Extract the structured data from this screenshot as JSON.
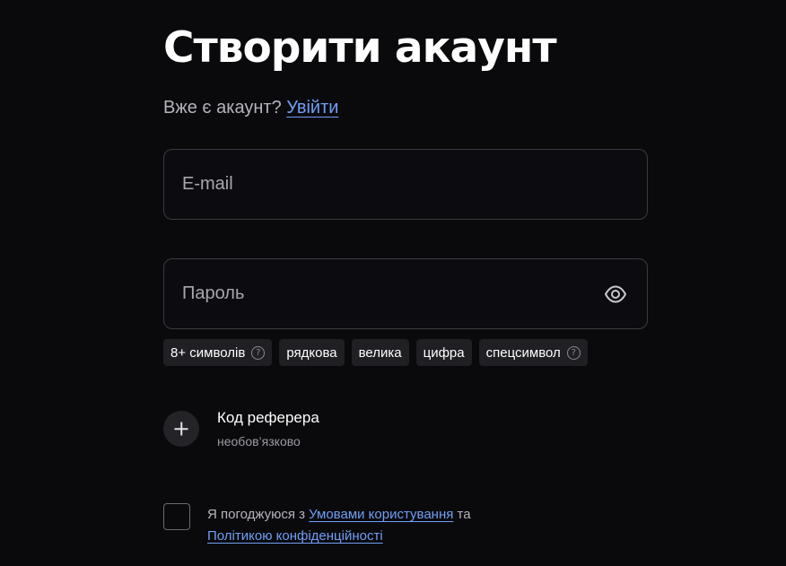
{
  "title": "Створити акаунт",
  "login": {
    "prompt": "Вже є акаунт?",
    "link": "Увійти"
  },
  "email": {
    "placeholder": "E-mail",
    "value": ""
  },
  "password": {
    "placeholder": "Пароль",
    "value": "",
    "toggle_icon": "eye-icon"
  },
  "requirements": [
    {
      "label": "8+ символів",
      "has_help": true
    },
    {
      "label": "рядкова",
      "has_help": false
    },
    {
      "label": "велика",
      "has_help": false
    },
    {
      "label": "цифра",
      "has_help": false
    },
    {
      "label": "спецсимвол",
      "has_help": true
    }
  ],
  "help_glyph": "?",
  "referral": {
    "title": "Код реферера",
    "subtitle": "необов’язково",
    "icon": "plus-icon"
  },
  "agreement": {
    "prefix": "Я погоджуюся з",
    "terms_link": "Умовами користування",
    "middle": "та",
    "privacy_link": "Політикою конфіденційності",
    "checked": false
  },
  "colors": {
    "background": "#0a0a0d",
    "link": "#6f9ff5",
    "chip_bg": "#1f1f24",
    "border": "#3a3a42"
  }
}
